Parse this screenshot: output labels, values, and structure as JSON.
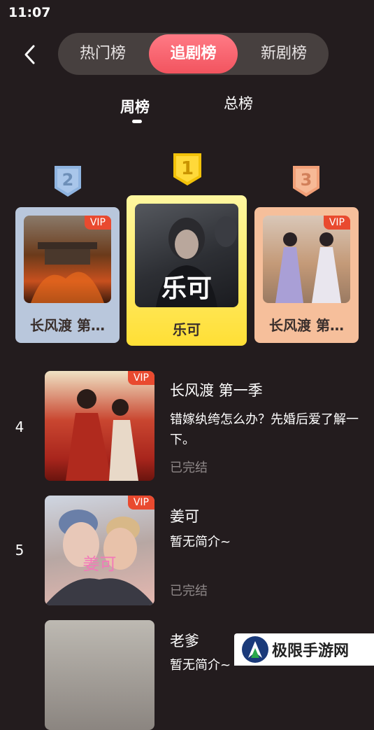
{
  "status_bar": {
    "time": "11:07"
  },
  "top_tabs": [
    {
      "label": "热门榜",
      "active": false
    },
    {
      "label": "追剧榜",
      "active": true
    },
    {
      "label": "新剧榜",
      "active": false
    }
  ],
  "sub_tabs": [
    {
      "label": "周榜",
      "active": true
    },
    {
      "label": "总榜",
      "active": false
    }
  ],
  "podium": [
    {
      "rank": "2",
      "title": "长风渡 第…",
      "vip": "VIP"
    },
    {
      "rank": "1",
      "title": "乐可",
      "cover_text": "乐可",
      "vip": ""
    },
    {
      "rank": "3",
      "title": "长风渡 第…",
      "vip": "VIP"
    }
  ],
  "list": [
    {
      "rank": "4",
      "title": "长风渡  第一季",
      "desc": "错嫁纨绔怎么办？先婚后爱了解一下。",
      "status": "已完结",
      "vip": "VIP"
    },
    {
      "rank": "5",
      "title": "姜可",
      "desc": "暂无简介~",
      "status": "已完结",
      "vip": "VIP",
      "cover_text": "姜可"
    },
    {
      "rank": "",
      "title": "老爹",
      "desc": "暂无简介~",
      "status": "",
      "vip": ""
    }
  ],
  "watermark": {
    "text": "极限手游网"
  },
  "colors": {
    "accent": "#f2545f",
    "background": "#231c1e",
    "gold": "#ffdf35",
    "silver": "#b9c7dc",
    "bronze": "#f6bf9b"
  }
}
